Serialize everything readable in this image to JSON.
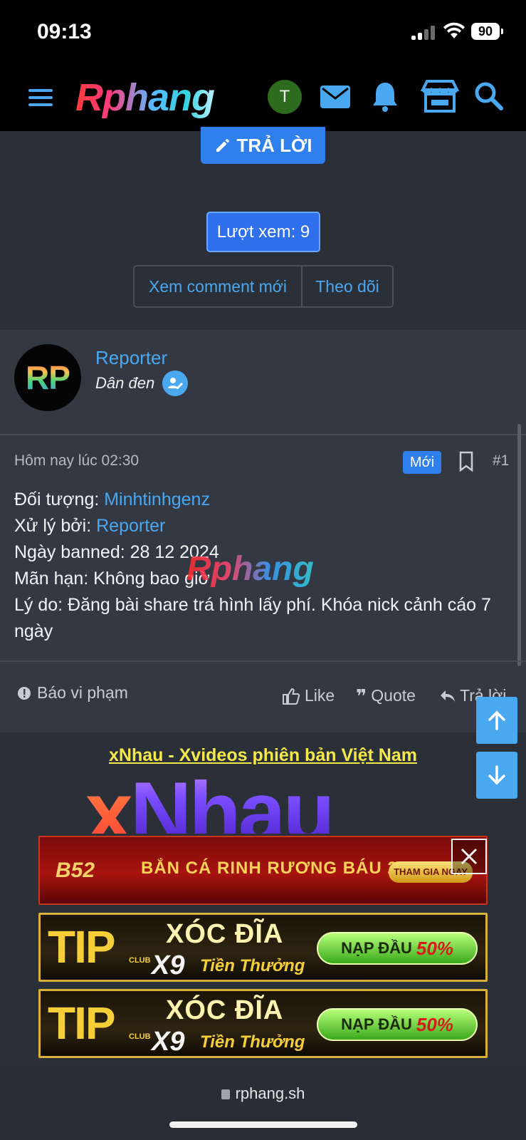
{
  "status_bar": {
    "time": "09:13",
    "battery": "90"
  },
  "topnav": {
    "logo": "Rphang",
    "user_initial": "T"
  },
  "thread": {
    "reply_label": "TRẢ LỜI",
    "views_label": "Lượt xem: 9",
    "view_new_comments": "Xem comment mới",
    "follow": "Theo dõi"
  },
  "post": {
    "avatar_text": "RP",
    "author": "Reporter",
    "author_title": "Dân đen",
    "time": "Hôm nay lúc 02:30",
    "new_badge": "Mới",
    "number": "#1",
    "lines": {
      "target_label": "Đối tượng: ",
      "target_value": "Minhtinhgenz",
      "handled_label": "Xử lý bởi: ",
      "handled_value": "Reporter",
      "banned_date": "Ngày banned: 28 12 2024",
      "expiry": "Mãn hạn: Không bao giờ",
      "reason": "Lý do: Đăng bài share trá hình lấy phí. Khóa nick cảnh cáo 7 ngày"
    },
    "watermark": "Rphang",
    "report_label": "Báo vi phạm",
    "like_label": "Like",
    "quote_label": "Quote",
    "reply_label": "Trả lời"
  },
  "ads": {
    "title": "xNhau - Xvideos phiên bản Việt Nam",
    "big_logo_x": "x",
    "big_logo_rest": "Nhau",
    "b52": {
      "logo": "B52",
      "text": "BẮN CÁ RINH  RƯƠNG BÁU 2,5M",
      "cta": "THAM GIA NGAY"
    },
    "tip": {
      "logo": "TIP",
      "club": "CLUB",
      "line1": "XÓC ĐĨA",
      "x9": "X9",
      "line2": "Tiền Thưởng",
      "cta1": "NẠP ĐẦU",
      "cta2": "50%"
    }
  },
  "browser": {
    "url": "rphang.sh"
  }
}
